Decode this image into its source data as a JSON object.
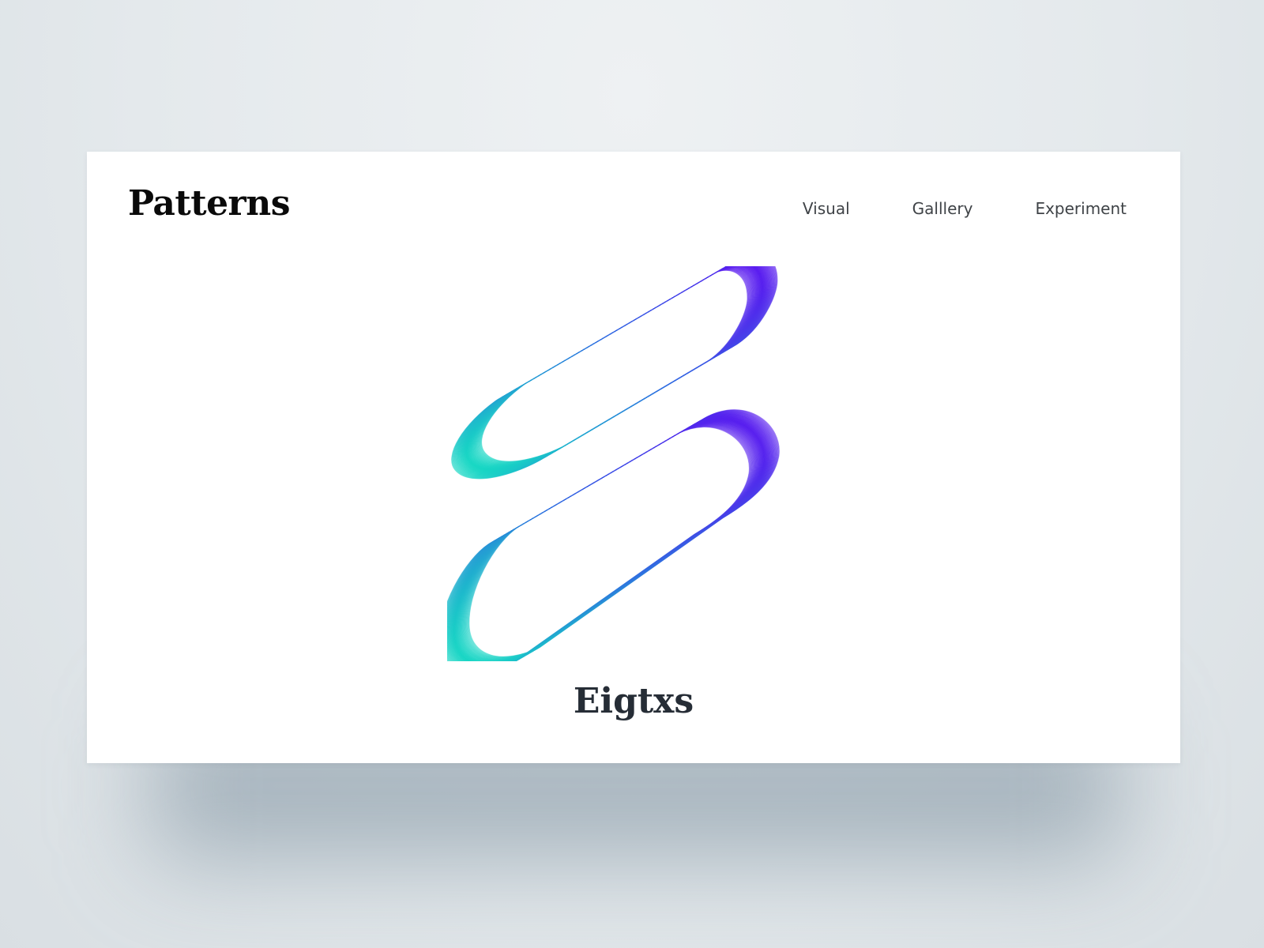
{
  "header": {
    "logo": "Patterns",
    "nav": [
      {
        "label": "Visual"
      },
      {
        "label": "Galllery"
      },
      {
        "label": "Experiment"
      }
    ]
  },
  "main": {
    "artwork_caption": "Eigtxs"
  },
  "colors": {
    "background": "#e4e9ec",
    "card": "#ffffff",
    "logo_text": "#0a0a0a",
    "nav_text": "#3f4347",
    "caption_text": "#262d36",
    "gradient_start": "#14dcc2",
    "gradient_mid": "#2f6fe0",
    "gradient_end": "#5a14f0"
  }
}
